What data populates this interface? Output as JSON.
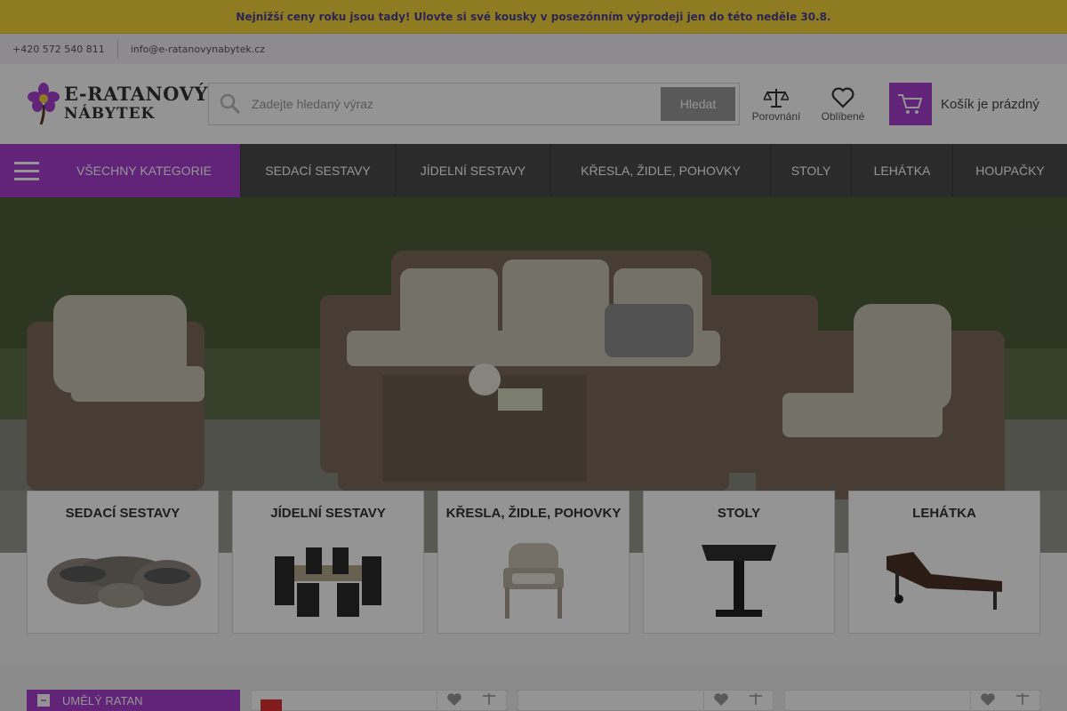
{
  "promo": {
    "text": "Nejnižší ceny roku jsou tady! Ulovte si své kousky v posezónním výprodeji jen do této neděle 30.8."
  },
  "contact": {
    "phone": "+420 572 540 811",
    "email": "info@e-ratanovynabytek.cz"
  },
  "logo": {
    "line1": "E-RATANOVÝ",
    "line2": "NÁBYTEK",
    "icon": "flower-logo-icon"
  },
  "search": {
    "placeholder": "Zadejte hledaný výraz",
    "value": "",
    "button": "Hledat",
    "icon": "search-icon"
  },
  "header": {
    "compare_label": "Porovnání",
    "favorites_label": "Oblíbené",
    "cart_label": "Košík je prázdný"
  },
  "nav": {
    "all_categories": "VŠECHNY KATEGORIE",
    "items": [
      {
        "label": "SEDACÍ SESTAVY"
      },
      {
        "label": "JÍDELNÍ SESTAVY"
      },
      {
        "label": "KŘESLA, ŽIDLE, POHOVKY"
      },
      {
        "label": "STOLY"
      },
      {
        "label": "LEHÁTKA"
      },
      {
        "label": "HOUPAČKY"
      }
    ]
  },
  "categories": [
    {
      "title": "SEDACÍ SESTAVY"
    },
    {
      "title": "JÍDELNÍ SESTAVY"
    },
    {
      "title": "KŘESLA, ŽIDLE, POHOVKY"
    },
    {
      "title": "STOLY"
    },
    {
      "title": "LEHÁTKA"
    }
  ],
  "sidebar": {
    "first_item": "UMĚLÝ RATAN",
    "toggle": "−"
  },
  "colors": {
    "accent": "#a93fd0",
    "promo_bg": "#f6d53a",
    "promo_text": "#4a4090",
    "nav_bg": "#4a4a4a"
  }
}
